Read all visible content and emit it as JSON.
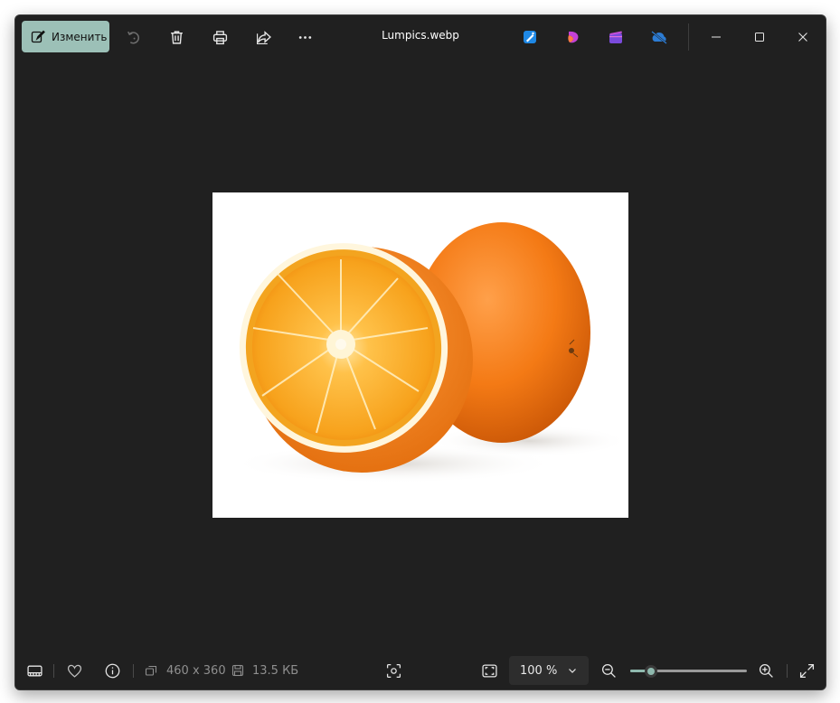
{
  "app": {
    "file_name": "Lumpics.webp",
    "accent_color": "#9cc0b7"
  },
  "toolbar": {
    "edit_label": "Изменить",
    "icons": [
      "edit-icon",
      "rotate-icon",
      "delete-icon",
      "print-icon",
      "share-icon",
      "more-icon"
    ],
    "apps": [
      "paint-app-icon",
      "clipchamp-icon",
      "video-editor-icon",
      "onedrive-icon"
    ],
    "window_controls": [
      "minimize-icon",
      "maximize-icon",
      "close-icon"
    ]
  },
  "image": {
    "subject": "orange-photo"
  },
  "bottom": {
    "dimensions": "460 x 360",
    "file_size": "13.5 КБ",
    "zoom_value": "100 %",
    "zoom_level": 0.18,
    "icons": [
      "filmstrip-icon",
      "favorite-icon",
      "info-icon",
      "dimensions-icon",
      "disk-icon",
      "fit-screen-icon",
      "zoom-out-icon",
      "zoom-in-icon",
      "fullscreen-icon"
    ]
  }
}
